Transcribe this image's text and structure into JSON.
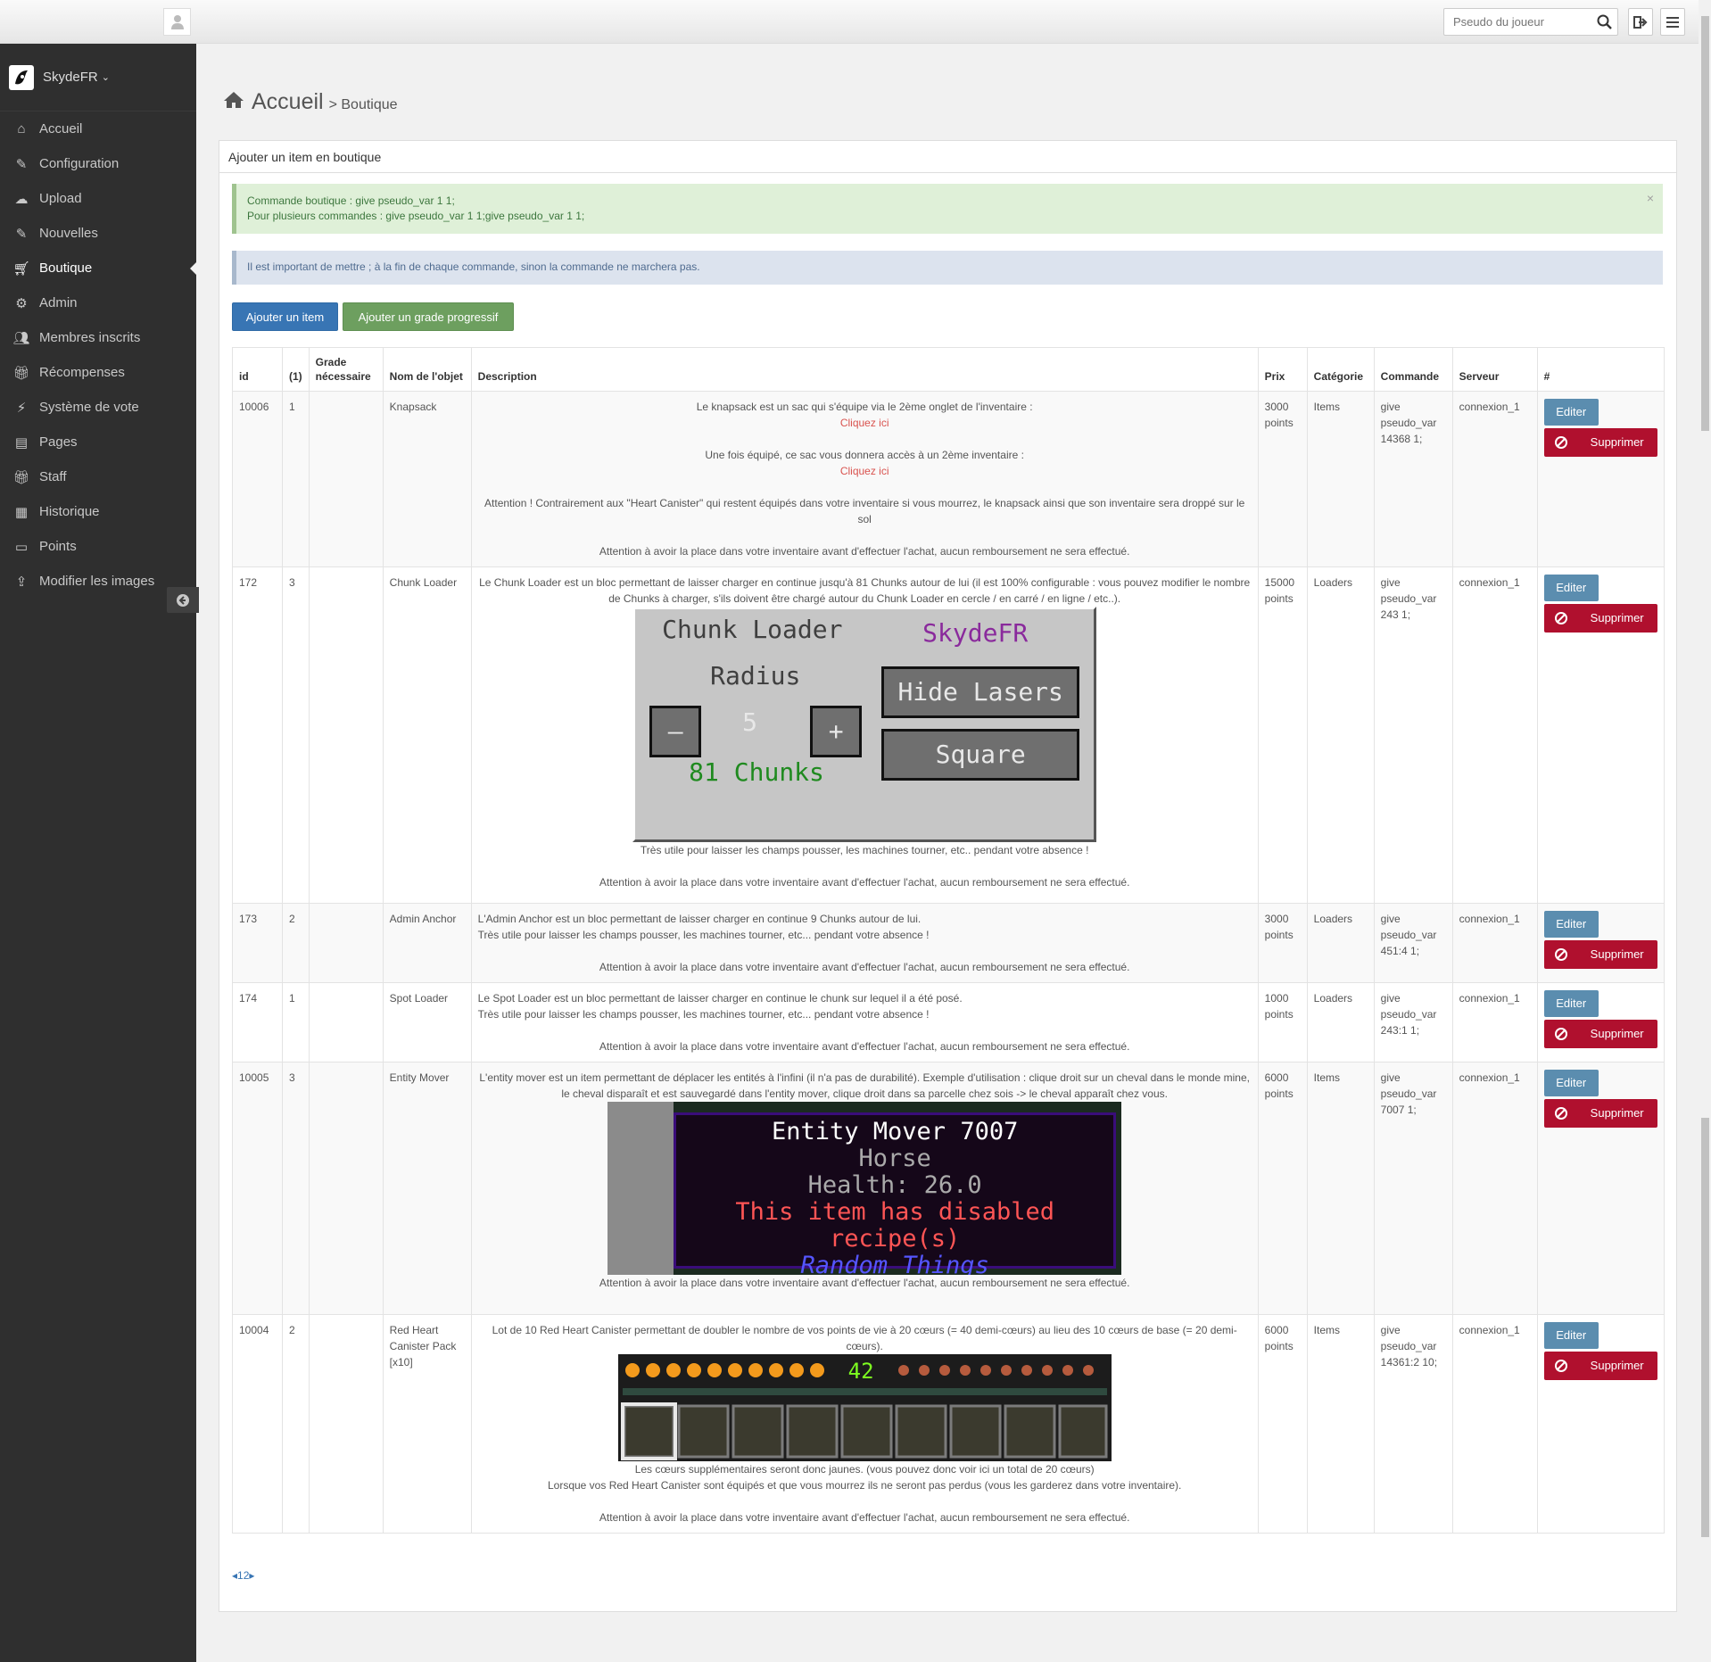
{
  "topbar": {
    "search_placeholder": "Pseudo du joueur",
    "icons": [
      "user-icon",
      "search-icon",
      "logout-icon",
      "menu-icon"
    ]
  },
  "sidebar": {
    "brand": "SkydeFR",
    "items": [
      {
        "label": "Accueil",
        "icon": "home-icon"
      },
      {
        "label": "Configuration",
        "icon": "edit-icon"
      },
      {
        "label": "Upload",
        "icon": "cloud-upload-icon"
      },
      {
        "label": "Nouvelles",
        "icon": "edit-icon"
      },
      {
        "label": "Boutique",
        "icon": "cart-icon",
        "active": true
      },
      {
        "label": "Admin",
        "icon": "gears-icon"
      },
      {
        "label": "Membres inscrits",
        "icon": "users-icon"
      },
      {
        "label": "Récompenses",
        "icon": "gift-icon"
      },
      {
        "label": "Système de vote",
        "icon": "bolt-icon"
      },
      {
        "label": "Pages",
        "icon": "book-icon"
      },
      {
        "label": "Staff",
        "icon": "gift-icon"
      },
      {
        "label": "Historique",
        "icon": "calendar-icon"
      },
      {
        "label": "Points",
        "icon": "credit-card-icon"
      },
      {
        "label": "Modifier les images",
        "icon": "upload-icon"
      }
    ]
  },
  "breadcrumb": {
    "home": "Accueil",
    "current": "> Boutique"
  },
  "panel": {
    "title": "Ajouter un item en boutique",
    "alert_success_line1": "Commande boutique : give pseudo_var 1 1;",
    "alert_success_line2": "Pour plusieurs commandes : give pseudo_var 1 1;give pseudo_var 1 1;",
    "alert_success_close": "×",
    "alert_info": "Il est important de mettre ; à la fin de chaque commande, sinon la commande ne marchera pas.",
    "btn_add_item": "Ajouter un item",
    "btn_add_grade": "Ajouter un grade progressif"
  },
  "table": {
    "headers": {
      "id": "id",
      "n": "(1)",
      "grade": "Grade nécessaire",
      "name": "Nom de l'objet",
      "desc": "Description",
      "price": "Prix",
      "cat": "Catégorie",
      "cmd": "Commande",
      "server": "Serveur",
      "actions": "#"
    },
    "edit_label": "Editer",
    "delete_label": "Supprimer",
    "warning": "Attention à avoir la place dans votre inventaire avant d'effectuer l'achat, aucun remboursement ne sera effectué.",
    "rows": [
      {
        "id": "10006",
        "n": "1",
        "grade": "",
        "name": "Knapsack",
        "d1": "Le knapsack est un sac qui s'équipe via le 2ème onglet de l'inventaire :",
        "link1": "Cliquez ici",
        "d2": "Une fois équipé, ce sac vous donnera accès à un 2ème inventaire :",
        "link2": "Cliquez ici",
        "d3": "Attention ! Contrairement aux \"Heart Canister\" qui restent équipés dans votre inventaire si vous mourrez, le knapsack ainsi que son inventaire sera droppé sur le sol",
        "price": "3000 points",
        "cat": "Items",
        "cmd": "give pseudo_var 14368 1;",
        "server": "connexion_1"
      },
      {
        "id": "172",
        "n": "3",
        "grade": "",
        "name": "Chunk Loader",
        "d1": "Le Chunk Loader est un bloc permettant de laisser charger en continue jusqu'à 81 Chunks autour de lui (il est 100% configurable : vous pouvez modifier le nombre de Chunks à charger, s'ils doivent être chargé autour du Chunk Loader en cercle / en carré / en ligne / etc..).",
        "d2": "Très utile pour laisser les champs pousser, les machines tourner, etc.. pendant votre absence !",
        "img": {
          "title": "Chunk Loader",
          "brand": "SkydeFR",
          "radius": "Radius",
          "minus": "–",
          "value": "5",
          "plus": "+",
          "chunks": "81 Chunks",
          "btn1": "Hide Lasers",
          "btn2": "Square"
        },
        "price": "15000 points",
        "cat": "Loaders",
        "cmd": "give pseudo_var 243 1;",
        "server": "connexion_1"
      },
      {
        "id": "173",
        "n": "2",
        "grade": "",
        "name": "Admin Anchor",
        "d1": "L'Admin Anchor est un bloc permettant de laisser charger en continue 9 Chunks autour de lui.",
        "d2": "Très utile pour laisser les champs pousser, les machines tourner, etc... pendant votre absence !",
        "price": "3000 points",
        "cat": "Loaders",
        "cmd": "give pseudo_var 451:4 1;",
        "server": "connexion_1"
      },
      {
        "id": "174",
        "n": "1",
        "grade": "",
        "name": "Spot Loader",
        "d1": "Le Spot Loader est un bloc permettant de laisser charger en continue le chunk sur lequel il a été posé.",
        "d2": "Très utile pour laisser les champs pousser, les machines tourner, etc... pendant votre absence !",
        "price": "1000 points",
        "cat": "Loaders",
        "cmd": "give pseudo_var 243:1 1;",
        "server": "connexion_1"
      },
      {
        "id": "10005",
        "n": "3",
        "grade": "",
        "name": "Entity Mover",
        "d1": "L'entity mover est un item permettant de déplacer les entités à l'infini (il n'a pas de durabilité). Exemple d'utilisation : clique droit sur un cheval dans le monde mine, le cheval disparaît et est sauvegardé dans l'entity mover, clique droit dans sa parcelle chez sois -> le cheval apparaît chez vous.",
        "img": {
          "l1": "Entity Mover 7007",
          "l2": "Horse",
          "l3": "Health: 26.0",
          "l4": "This item has disabled recipe(s)",
          "l5": "Random Things"
        },
        "price": "6000 points",
        "cat": "Items",
        "cmd": "give pseudo_var 7007 1;",
        "server": "connexion_1"
      },
      {
        "id": "10004",
        "n": "2",
        "grade": "",
        "name": "Red Heart Canister Pack [x10]",
        "d1": "Lot de 10 Red Heart Canister permettant de doubler le nombre de vos points de vie à 20 cœurs (= 40 demi-cœurs) au lieu des 10 cœurs de base (= 20 demi-cœurs).",
        "img": {
          "level": "42"
        },
        "d2": "Les cœurs supplémentaires seront donc jaunes. (vous pouvez donc voir ici un total de 20 cœurs)",
        "d3": "Lorsque vos Red Heart Canister sont équipés et que vous mourrez ils ne seront pas perdus (vous les garderez dans votre inventaire).",
        "price": "6000 points",
        "cat": "Items",
        "cmd": "give pseudo_var 14361:2 10;",
        "server": "connexion_1"
      }
    ]
  },
  "pager": {
    "prev": "◂",
    "pages": "12",
    "next": "▸"
  }
}
